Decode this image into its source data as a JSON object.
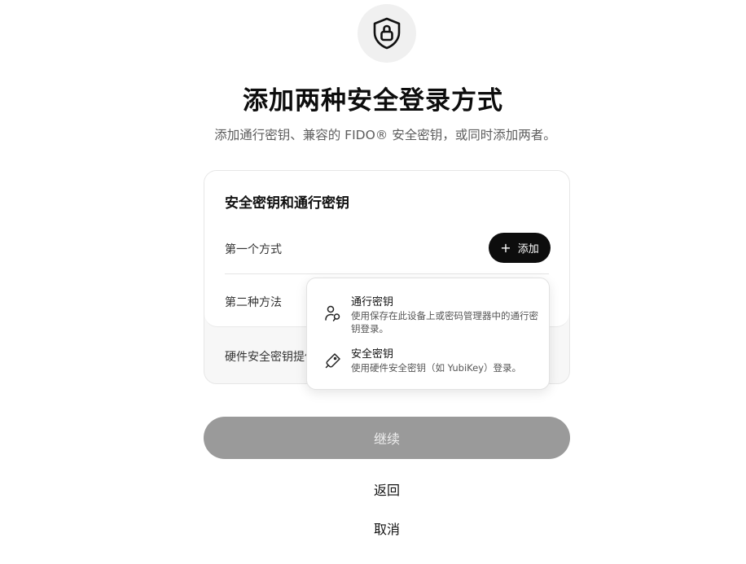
{
  "header": {
    "icon": "shield-lock-icon",
    "title": "添加两种安全登录方式",
    "subtitle": "添加通行密钥、兼容的 FIDO® 安全密钥，或同时添加两者。"
  },
  "card": {
    "title": "安全密钥和通行密钥",
    "first_method_label": "第一个方式",
    "second_method_label": "第二种方法",
    "add_button_label": "添加",
    "add_button_icon": "plus-icon",
    "footer_text": "硬件安全密钥提供"
  },
  "dropdown": {
    "items": [
      {
        "icon": "person-key-icon",
        "title": "通行密钥",
        "description": "使用保存在此设备上或密码管理器中的通行密钥登录。"
      },
      {
        "icon": "usb-key-icon",
        "title": "安全密钥",
        "description": "使用硬件安全密钥（如 YubiKey）登录。"
      }
    ]
  },
  "actions": {
    "continue_label": "继续",
    "back_label": "返回",
    "cancel_label": "取消"
  },
  "colors": {
    "primary_button": "#0d0d0d",
    "disabled_button": "#9a9a9a",
    "icon_circle_bg": "#f0f0f0"
  }
}
